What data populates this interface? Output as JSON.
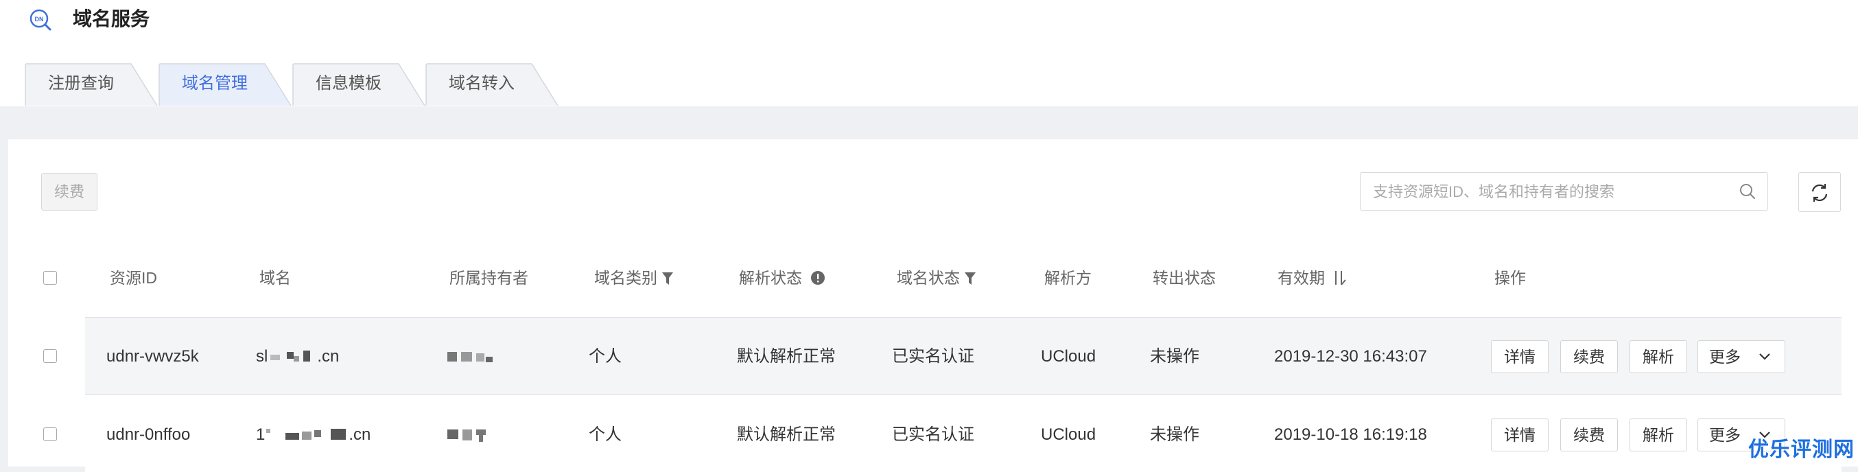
{
  "app": {
    "title": "域名服务",
    "icon": "dns-search-icon",
    "icon_text": "DN"
  },
  "tabs": [
    {
      "label": "注册查询",
      "active": false
    },
    {
      "label": "域名管理",
      "active": true
    },
    {
      "label": "信息模板",
      "active": false
    },
    {
      "label": "域名转入",
      "active": false
    }
  ],
  "toolbar": {
    "renew_label": "续费"
  },
  "search": {
    "placeholder": "支持资源短ID、域名和持有者的搜索",
    "value": ""
  },
  "table": {
    "columns": [
      "资源ID",
      "域名",
      "所属持有者",
      "域名类别",
      "解析状态",
      "域名状态",
      "解析方",
      "转出状态",
      "有效期",
      "操作"
    ],
    "rows": [
      {
        "resource_id": "udnr-vwvz5k",
        "domain_prefix": "sl",
        "domain_suffix": ".cn",
        "category": "个人",
        "dns_status": "默认解析正常",
        "domain_status": "已实名认证",
        "resolver": "UCloud",
        "transfer_status": "未操作",
        "expires": "2019-12-30 16:43:07"
      },
      {
        "resource_id": "udnr-0nffoo",
        "domain_prefix": "1",
        "domain_suffix": ".cn",
        "category": "个人",
        "dns_status": "默认解析正常",
        "domain_status": "已实名认证",
        "resolver": "UCloud",
        "transfer_status": "未操作",
        "expires": "2019-10-18 16:19:18"
      }
    ],
    "actions": {
      "detail": "详情",
      "renew": "续费",
      "resolve": "解析",
      "more": "更多"
    }
  },
  "watermark": "优乐评测网",
  "colors": {
    "accent": "#3f6fd8",
    "watermark": "#1e6fe0",
    "page_bg": "#eef0f4"
  }
}
